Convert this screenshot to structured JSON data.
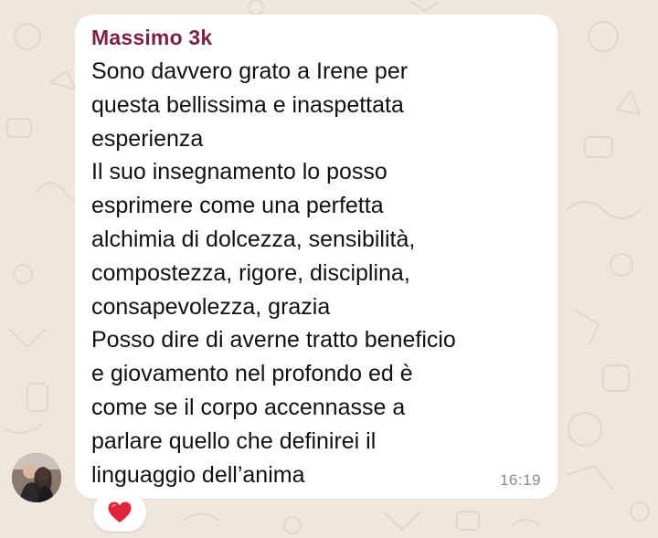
{
  "chat": {
    "message": {
      "sender": "Massimo 3k",
      "lines": [
        "Sono davvero grato a Irene per",
        "questa bellissima e inaspettata",
        "esperienza",
        "Il suo insegnamento lo posso",
        "esprimere come una perfetta",
        "alchimia di dolcezza, sensibilità,",
        "compostezza, rigore, disciplina,",
        "consapevolezza, grazia",
        "Posso dire di averne tratto beneficio",
        "e giovamento nel profondo ed è",
        "come se il corpo accennasse a",
        "parlare quello che definirei il",
        "linguaggio dell’anima"
      ],
      "time": "16:19",
      "reaction": "red-heart-icon"
    }
  },
  "colors": {
    "wallpaper": "#efe7dd",
    "bubble": "#ffffff",
    "sender_name": "#7a2248",
    "timestamp": "#8a8a8a",
    "heart": "#e0243a"
  }
}
